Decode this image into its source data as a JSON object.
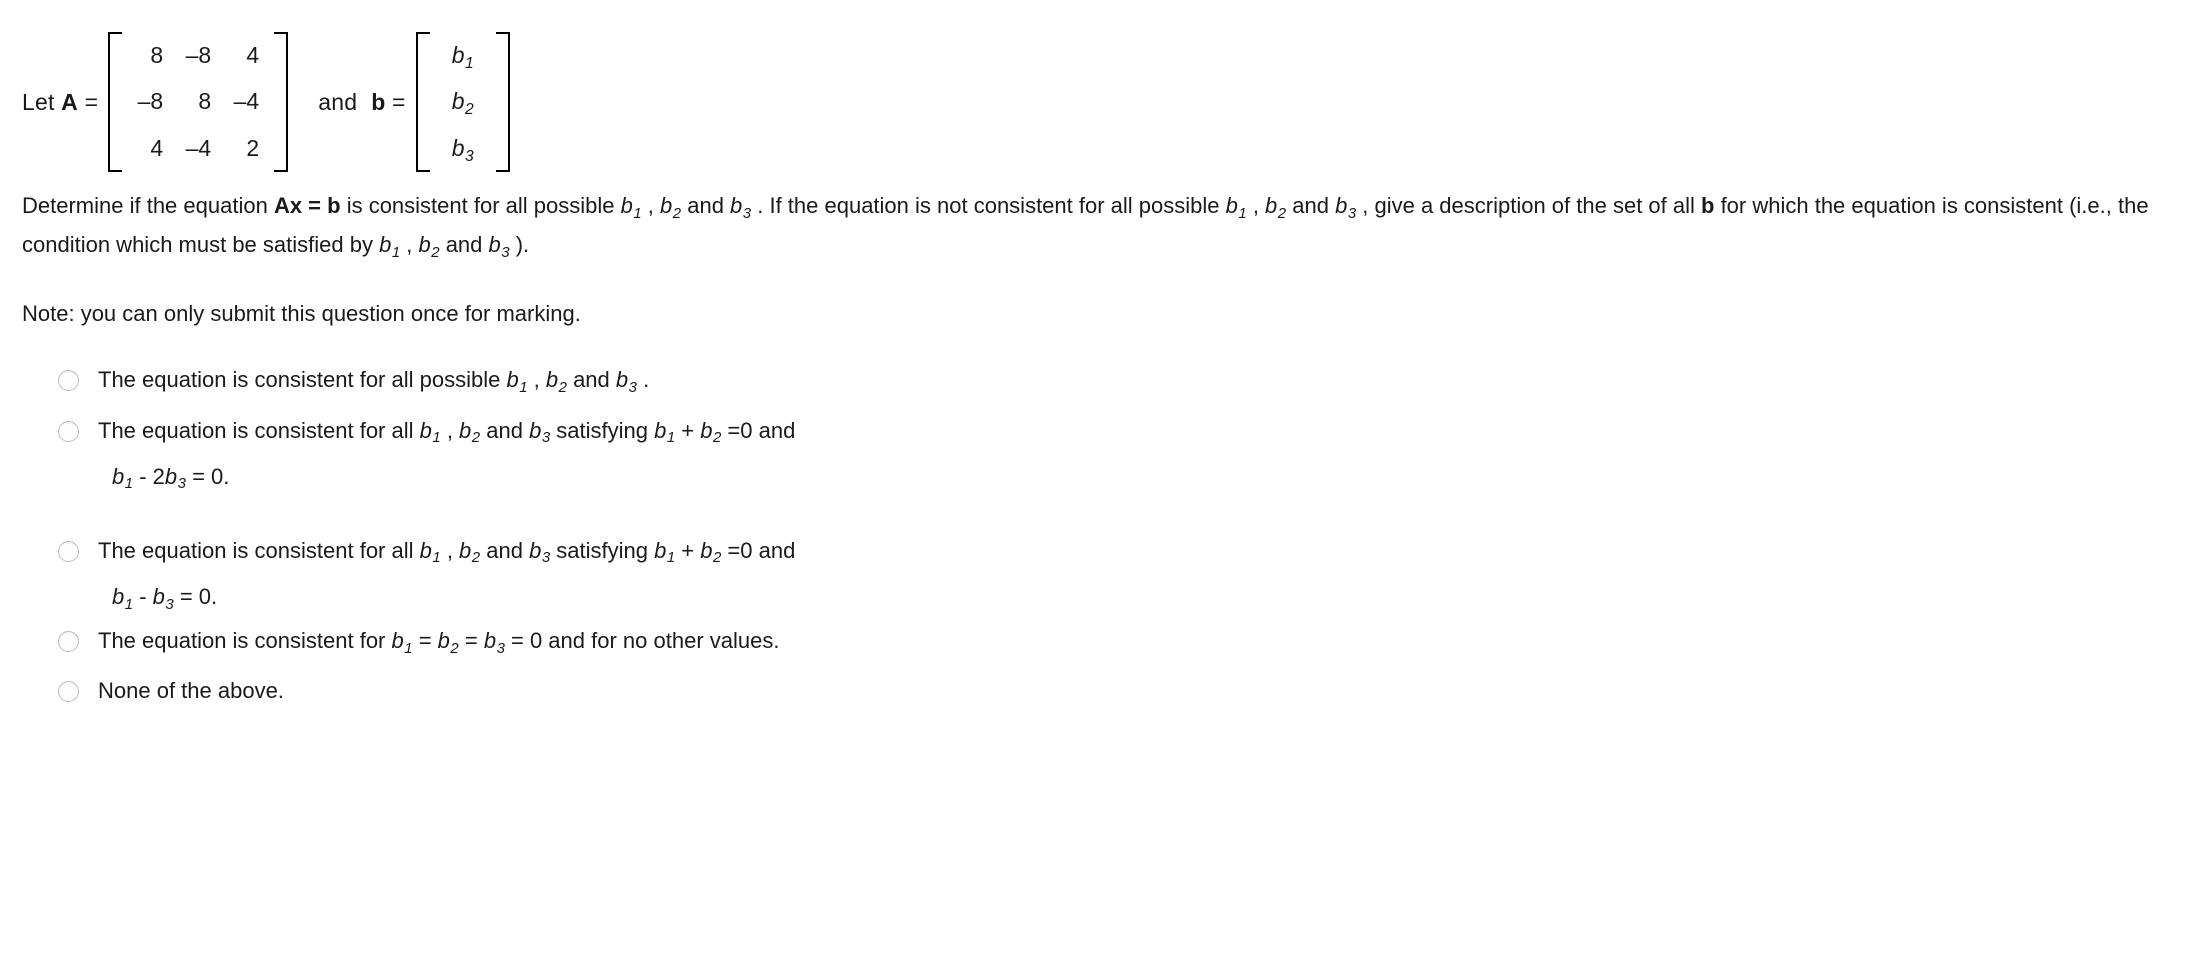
{
  "definition": {
    "let_label": "Let ",
    "A_symbol": "A",
    "equals": " = ",
    "and_label": "and",
    "b_symbol": "b",
    "matrix_A": {
      "rows": [
        [
          "8",
          "–8",
          "4"
        ],
        [
          "–8",
          "8",
          "–4"
        ],
        [
          "4",
          "–4",
          "2"
        ]
      ]
    },
    "vector_b": {
      "entries": [
        {
          "base": "b",
          "sub": "1"
        },
        {
          "base": "b",
          "sub": "2"
        },
        {
          "base": "b",
          "sub": "3"
        }
      ]
    }
  },
  "question": {
    "part1": "Determine if the equation ",
    "equation_bold": "Ax = b",
    "part2": " is consistent for all possible ",
    "b1": "b",
    "b1s": "1",
    "sep1": " , ",
    "b2": "b",
    "b2s": "2",
    "sep2": " and ",
    "b3": "b",
    "b3s": "3",
    "part3": " . If the equation is not consistent for all possible ",
    "b4": "b",
    "b4s": "1",
    "sep3": " , ",
    "b5": "b",
    "b5s": "2",
    "sep4": " and ",
    "b6": "b",
    "b6s": "3",
    "part4": " , give a description of the set of all ",
    "b_bold": "b",
    "part5": " for which the equation is consistent (i.e., the condition which must be satisfied by ",
    "b7": "b",
    "b7s": "1",
    "sep5": " , ",
    "b8": "b",
    "b8s": "2",
    "sep6": " and ",
    "b9": "b",
    "b9s": "3",
    "part6": " )."
  },
  "note": "Note: you can only submit this question once for marking.",
  "options": [
    {
      "id": "option-1",
      "selected": false,
      "lead": "The equation is consistent for all possible ",
      "v1": "b",
      "v1s": "1",
      "s1": " , ",
      "v2": "b",
      "v2s": "2",
      "s2": " and ",
      "v3": "b",
      "v3s": "3",
      "tail": " ."
    },
    {
      "id": "option-2",
      "selected": false,
      "lead": "The equation is consistent for all ",
      "v1": "b",
      "v1s": "1",
      "s1": " , ",
      "v2": "b",
      "v2s": "2",
      "s2": " and ",
      "v3": "b",
      "v3s": "3",
      "s3": " satisfying ",
      "v4": "b",
      "v4s": "1",
      "s4": " + ",
      "v5": "b",
      "v5s": "2",
      "tail": " =0 and",
      "continuation": {
        "c1": "b",
        "c1s": "1",
        "cmid": " - 2",
        "c2": "b",
        "c2s": "3",
        "cend": " = 0."
      }
    },
    {
      "id": "option-3",
      "selected": false,
      "lead": "The equation is consistent for all ",
      "v1": "b",
      "v1s": "1",
      "s1": " , ",
      "v2": "b",
      "v2s": "2",
      "s2": " and ",
      "v3": "b",
      "v3s": "3",
      "s3": " satisfying ",
      "v4": "b",
      "v4s": "1",
      "s4": " + ",
      "v5": "b",
      "v5s": "2",
      "tail": " =0 and",
      "continuation": {
        "c1": "b",
        "c1s": "1",
        "cmid": " - ",
        "c2": "b",
        "c2s": "3",
        "cend": " = 0."
      }
    },
    {
      "id": "option-4",
      "selected": false,
      "lead": "The equation is consistent for ",
      "v1": "b",
      "v1s": "1",
      "s1": " = ",
      "v2": "b",
      "v2s": "2",
      "s2": " = ",
      "v3": "b",
      "v3s": "3",
      "tail": " = 0 and for no other values."
    },
    {
      "id": "option-5",
      "selected": false,
      "lead": "None of the above.",
      "tail": ""
    }
  ],
  "colors": {
    "background": "#ffffff",
    "text": "#1a1a1a",
    "radio_border": "#bdbdbd"
  }
}
